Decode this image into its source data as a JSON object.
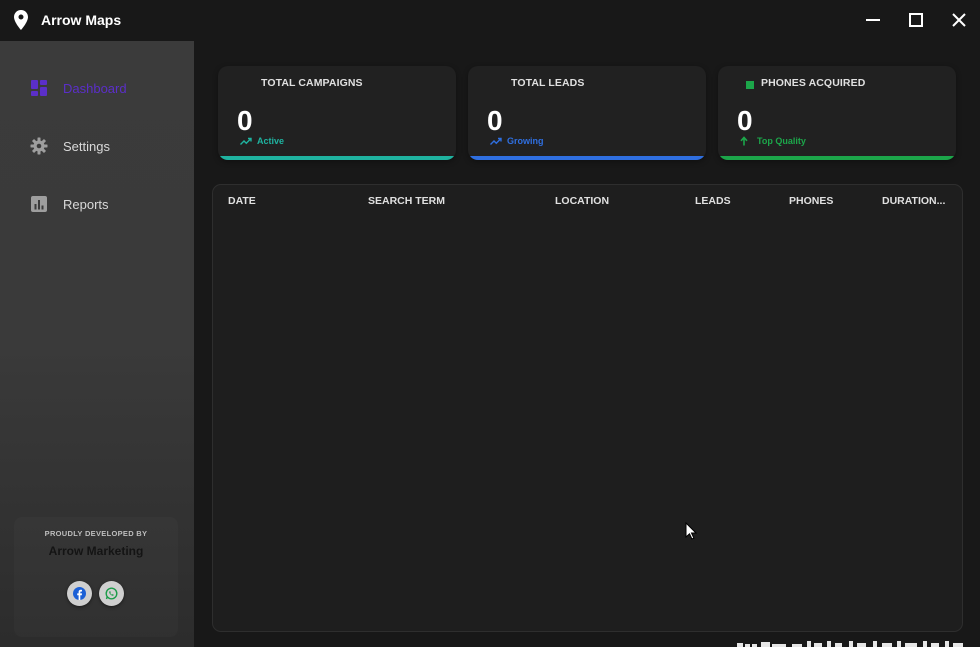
{
  "app": {
    "title": "Arrow Maps",
    "icon": "map-pin-icon"
  },
  "window_controls": {
    "minimize_icon": "minimize-icon",
    "maximize_icon": "maximize-icon",
    "close_icon": "close-icon"
  },
  "sidebar": {
    "items": [
      {
        "label": "Dashboard",
        "icon": "dashboard-icon",
        "active": true
      },
      {
        "label": "Settings",
        "icon": "gear-icon",
        "active": false
      },
      {
        "label": "Reports",
        "icon": "bar-chart-icon",
        "active": false
      }
    ],
    "active_color": "#5b2fc9",
    "credits": {
      "caption": "PROUDLY DEVELOPED BY",
      "name": "Arrow Marketing"
    },
    "social": [
      {
        "icon": "facebook-icon"
      },
      {
        "icon": "whatsapp-icon"
      }
    ]
  },
  "stats": [
    {
      "title": "TOTAL CAMPAIGNS",
      "value": "0",
      "sub": "Active",
      "sub_icon": "trending-up-icon",
      "accent": "#1fb3a0"
    },
    {
      "title": "TOTAL LEADS",
      "value": "0",
      "sub": "Growing",
      "sub_icon": "trending-up-icon",
      "accent": "#2f6fe0"
    },
    {
      "title": "PHONES ACQUIRED",
      "value": "0",
      "sub": "Top Quality",
      "sub_icon": "arrow-up-icon",
      "accent": "#1ca64a",
      "title_icon": "square-icon"
    }
  ],
  "table": {
    "columns": [
      "DATE",
      "SEARCH TERM",
      "LOCATION",
      "LEADS",
      "PHONES",
      "DURATION..."
    ],
    "rows": []
  }
}
